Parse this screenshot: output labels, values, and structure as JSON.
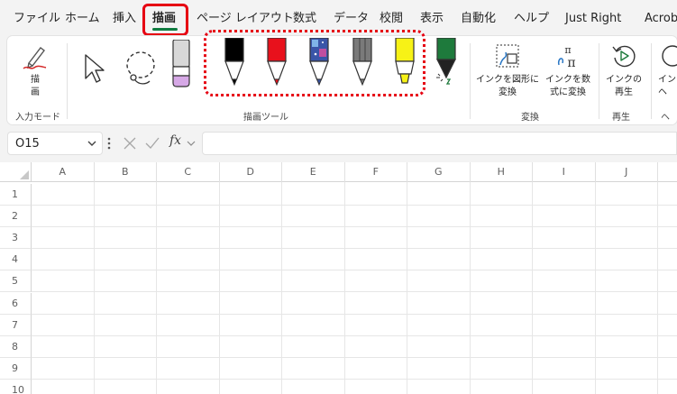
{
  "menu": {
    "items": [
      "ファイル",
      "ホーム",
      "挿入",
      "描画",
      "ページ レイアウト",
      "数式",
      "データ",
      "校閲",
      "表示",
      "自動化",
      "ヘルプ",
      "Just Right",
      "Acrob"
    ]
  },
  "ribbon": {
    "draw_button_label": "描\n画",
    "groups": {
      "input_mode": "入力モード",
      "drawing_tools": "描画ツール",
      "convert": "変換",
      "replay": "再生",
      "help_partial": "ヘ"
    },
    "convert_buttons": {
      "ink_to_shape": "インクを図形に\n変換",
      "ink_to_math": "インクを数\n式に変換"
    },
    "replay_buttons": {
      "ink_replay": "インクの\n再生",
      "partial": "イン\nヘ"
    },
    "pens": [
      {
        "name": "black-pen",
        "color": "#000000"
      },
      {
        "name": "red-pen",
        "color": "#e8111c"
      },
      {
        "name": "galaxy-pen",
        "color": "#3a55a8"
      },
      {
        "name": "gray-pencil",
        "color": "#7a7a7a"
      },
      {
        "name": "yellow-highlighter",
        "color": "#f7f216"
      },
      {
        "name": "green-action-pen",
        "color": "#1e7a3c"
      }
    ]
  },
  "formula_bar": {
    "name_box": "O15",
    "fx": "fx",
    "value": ""
  },
  "grid": {
    "columns": [
      "A",
      "B",
      "C",
      "D",
      "E",
      "F",
      "G",
      "H",
      "I",
      "J"
    ],
    "rows": [
      "1",
      "2",
      "3",
      "4",
      "5",
      "6",
      "7",
      "8",
      "9",
      "10"
    ]
  },
  "colors": {
    "accent": "#107c41",
    "highlight": "#e60012"
  }
}
